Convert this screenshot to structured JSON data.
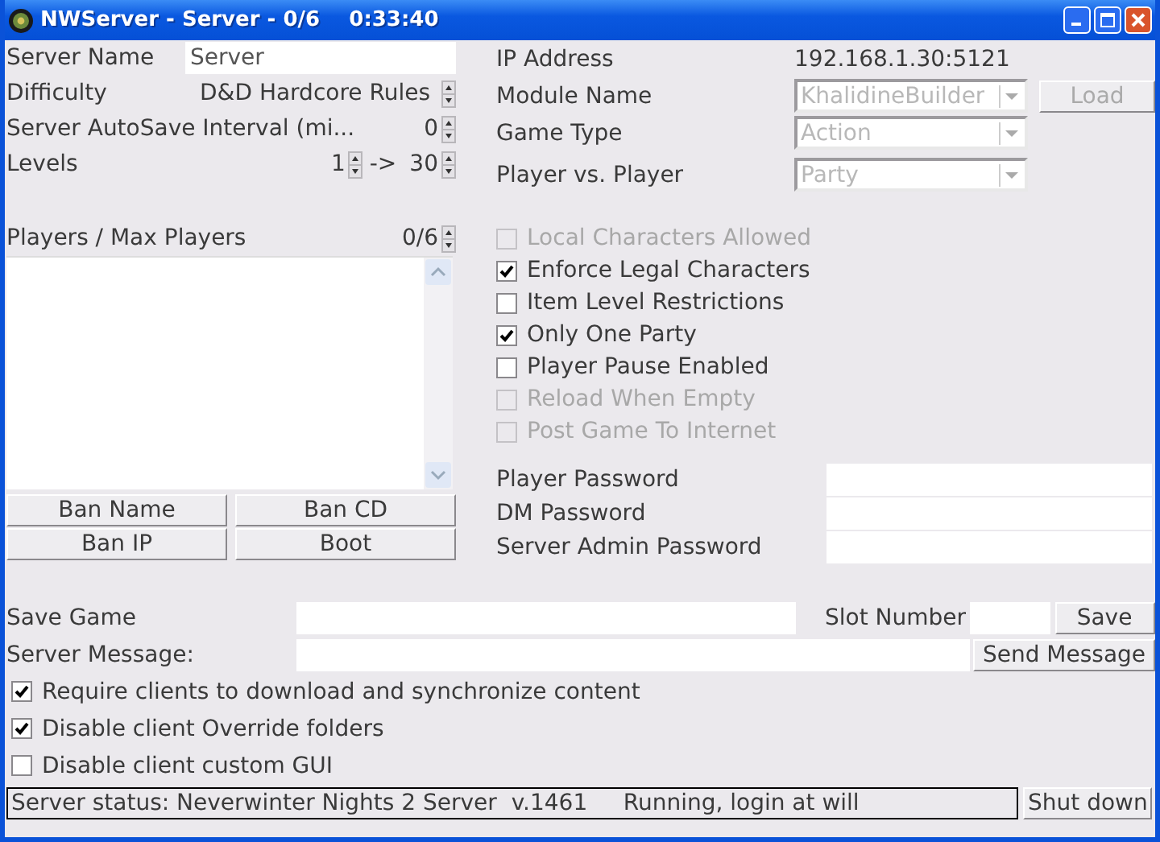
{
  "window": {
    "title": "NWServer - Server - 0/6    0:33:40"
  },
  "left": {
    "server_name": {
      "label": "Server Name",
      "value": "Server"
    },
    "difficulty": {
      "label": "Difficulty",
      "value": "D&D Hardcore Rules"
    },
    "autosave": {
      "label": "Server AutoSave Interval (mi...",
      "value": "0"
    },
    "levels": {
      "label": "Levels",
      "min": "1",
      "separator": "->",
      "max": "30"
    },
    "players": {
      "label": "Players / Max Players",
      "value": "0/6"
    },
    "buttons": [
      "Ban Name",
      "Ban CD",
      "Ban IP",
      "Boot"
    ]
  },
  "right": {
    "ip": {
      "label": "IP Address",
      "value": "192.168.1.30:5121"
    },
    "dropdowns": [
      {
        "label": "Module Name",
        "value": "KhalidineBuilder",
        "disabled": true
      },
      {
        "label": "Game Type",
        "value": "Action",
        "disabled": true
      },
      {
        "label": "Player vs. Player",
        "value": "Party",
        "disabled": true
      }
    ],
    "load_button": {
      "label": "Load",
      "disabled": true
    },
    "options": [
      {
        "label": "Local Characters Allowed",
        "checked": false,
        "disabled": true
      },
      {
        "label": "Enforce Legal Characters",
        "checked": true,
        "disabled": false
      },
      {
        "label": "Item Level Restrictions",
        "checked": false,
        "disabled": false
      },
      {
        "label": "Only One Party",
        "checked": true,
        "disabled": false
      },
      {
        "label": "Player Pause Enabled",
        "checked": false,
        "disabled": false
      },
      {
        "label": "Reload When Empty",
        "checked": false,
        "disabled": true
      },
      {
        "label": "Post Game To Internet",
        "checked": false,
        "disabled": true
      }
    ],
    "passwords": [
      {
        "label": "Player Password"
      },
      {
        "label": "DM Password"
      },
      {
        "label": "Server Admin Password"
      }
    ]
  },
  "bottom": {
    "save_game": {
      "label": "Save Game"
    },
    "slot_number": {
      "label": "Slot Number"
    },
    "save_button": "Save",
    "server_message": {
      "label": "Server Message:"
    },
    "send_button": "Send Message",
    "options": [
      {
        "label": "Require clients to download and synchronize content",
        "checked": true
      },
      {
        "label": "Disable client Override folders",
        "checked": true
      },
      {
        "label": "Disable client custom GUI",
        "checked": false
      }
    ],
    "status": "Server status: Neverwinter Nights 2 Server  v.1461     Running, login at will",
    "shutdown_button": "Shut down"
  }
}
